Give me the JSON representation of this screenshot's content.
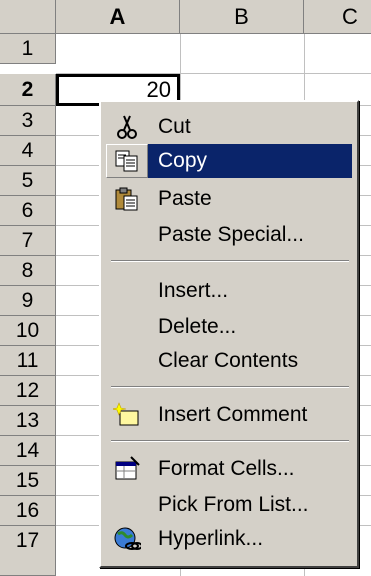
{
  "spreadsheet": {
    "columns": [
      "A",
      "B",
      "C"
    ],
    "rows": [
      "1",
      "2",
      "3",
      "4",
      "5",
      "6",
      "7",
      "8",
      "9",
      "10",
      "11",
      "12",
      "13",
      "14",
      "15",
      "16",
      "17"
    ],
    "active_cell_value": "20"
  },
  "context_menu": {
    "items": [
      {
        "label": "Cut",
        "icon": "scissors-icon"
      },
      {
        "label": "Copy",
        "icon": "copy-icon",
        "highlighted": true
      },
      {
        "label": "Paste",
        "icon": "paste-icon"
      },
      {
        "label": "Paste Special..."
      },
      {
        "label": "Insert..."
      },
      {
        "label": "Delete..."
      },
      {
        "label": "Clear Contents"
      },
      {
        "label": "Insert Comment",
        "icon": "comment-icon"
      },
      {
        "label": "Format Cells...",
        "icon": "format-cells-icon"
      },
      {
        "label": "Pick From List..."
      },
      {
        "label": "Hyperlink...",
        "icon": "hyperlink-icon"
      }
    ],
    "highlight_color": "#0a246a"
  }
}
